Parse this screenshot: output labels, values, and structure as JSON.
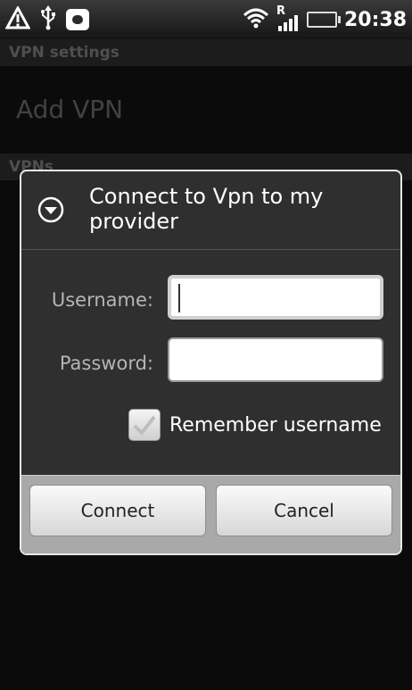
{
  "status_bar": {
    "time": "20:38",
    "roaming_indicator": "R",
    "icons": [
      "warning-icon",
      "usb-icon",
      "message-icon",
      "wifi-icon",
      "signal-icon",
      "battery-icon"
    ]
  },
  "settings_screen": {
    "header_title": "VPN settings",
    "add_vpn_label": "Add VPN",
    "vpns_section_label": "VPNs"
  },
  "dialog": {
    "title": "Connect to Vpn to my provider",
    "username_label": "Username:",
    "username_value": "",
    "password_label": "Password:",
    "password_value": "",
    "remember_label": "Remember username",
    "remember_checked": true,
    "connect_label": "Connect",
    "cancel_label": "Cancel"
  }
}
